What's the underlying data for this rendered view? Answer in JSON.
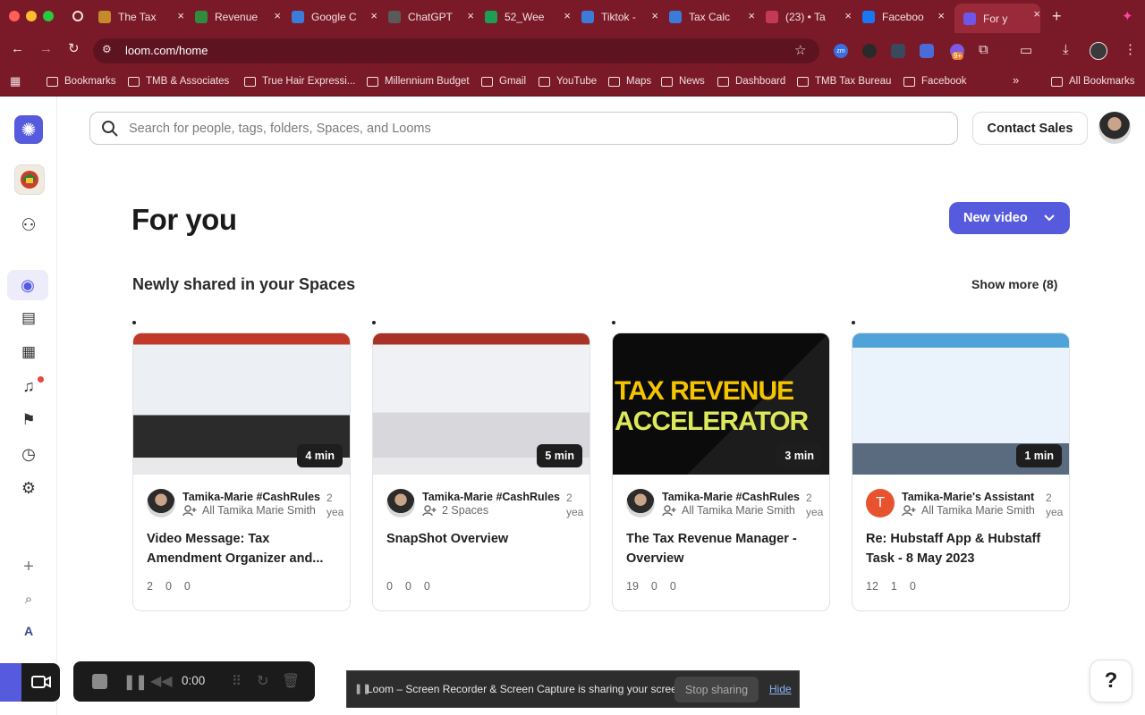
{
  "browser": {
    "tabs": [
      {
        "title": "The Tax",
        "fav_color": "#c58a2a"
      },
      {
        "title": "Revenue",
        "fav_color": "#2f8b3e"
      },
      {
        "title": "Google C",
        "fav_color": "#3b7bd9"
      },
      {
        "title": "ChatGPT",
        "fav_color": "#5a5a5a"
      },
      {
        "title": "52_Wee",
        "fav_color": "#1f9d55"
      },
      {
        "title": "Tiktok -",
        "fav_color": "#3b7bd9"
      },
      {
        "title": "Tax Calc",
        "fav_color": "#3b7bd9"
      },
      {
        "title": "(23) • Ta",
        "fav_color": "#c23a57"
      },
      {
        "title": "Faceboo",
        "fav_color": "#1877f2"
      },
      {
        "title": "For y",
        "fav_color": "#6e56e8"
      }
    ],
    "url": "loom.com/home",
    "bookmarks": [
      "Bookmarks",
      "TMB & Associates",
      "True Hair Expressi...",
      "Millennium Budget",
      "Gmail",
      "YouTube",
      "Maps",
      "News",
      "Dashboard",
      "TMB Tax Bureau",
      "Facebook"
    ],
    "all_bookmarks": "All Bookmarks",
    "ext_badge": "9+",
    "ext_zm": "zm"
  },
  "header": {
    "search_placeholder": "Search for people, tags, folders, Spaces, and Looms",
    "contact_sales": "Contact Sales"
  },
  "main": {
    "title": "For you",
    "new_video": "New video",
    "section_title": "Newly shared in your Spaces",
    "show_more": "Show more (8)"
  },
  "cards": [
    {
      "duration": "4 min",
      "author": "Tamika-Marie #CashRules",
      "age": "2 yea",
      "space": "All Tamika Marie Smith",
      "title": "Video Message: Tax Amendment Organizer and...",
      "views": "2",
      "comments": "0",
      "reactions": "0",
      "avatar_letter": ""
    },
    {
      "duration": "5 min",
      "author": "Tamika-Marie #CashRules",
      "age": "2 yea",
      "space": "2 Spaces",
      "title": "SnapShot Overview",
      "views": "0",
      "comments": "0",
      "reactions": "0",
      "avatar_letter": ""
    },
    {
      "duration": "3 min",
      "author": "Tamika-Marie #CashRules",
      "age": "2 yea",
      "space": "All Tamika Marie Smith",
      "title": "The Tax Revenue Manager - Overview",
      "views": "19",
      "comments": "0",
      "reactions": "0",
      "avatar_letter": "",
      "thumb_text": [
        "TAX REVENUE",
        "ACCELERATOR"
      ]
    },
    {
      "duration": "1 min",
      "author": "Tamika-Marie's Assistant",
      "age": "2 yea",
      "space": "All Tamika Marie Smith",
      "title": "Re: Hubstaff App & Hubstaff Task - 8 May 2023",
      "views": "12",
      "comments": "1",
      "reactions": "0",
      "avatar_letter": "T"
    }
  ],
  "recorder": {
    "timer": "0:00"
  },
  "sharing_bar": {
    "text": "Loom – Screen Recorder & Screen Capture is sharing your screen.",
    "stop": "Stop sharing",
    "hide": "Hide"
  },
  "help": "?",
  "rail": {
    "avatar_letter": "A"
  }
}
